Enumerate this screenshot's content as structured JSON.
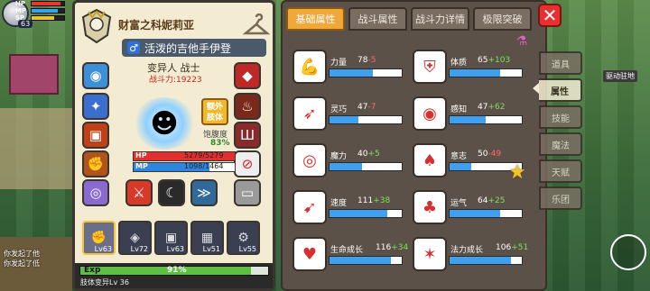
{
  "hud": {
    "hp_label": "HP",
    "mp_label": "MP",
    "sp_label": "SP",
    "level": "63"
  },
  "hero": {
    "name": "财富之科妮莉亚",
    "title": "活泼的吉他手伊登",
    "gender_symbol": "♂",
    "race_class": "变异人 战士",
    "power": "战斗力:19223",
    "extra_skill": "额外肢体",
    "satiety_label": "饱腹度",
    "satiety_value": "83%",
    "hp_label": "HP",
    "hp_value": "5279/5279",
    "hp_fraction": 1.0,
    "mp_label": "MP",
    "mp_value": "1098/1464",
    "mp_fraction": 0.75
  },
  "inventory": [
    {
      "level": "Lv63",
      "icon": "fist-icon",
      "selected": true
    },
    {
      "level": "Lv72",
      "icon": "crystal-icon",
      "selected": false
    },
    {
      "level": "Lv63",
      "icon": "armor-icon",
      "selected": false
    },
    {
      "level": "Lv51",
      "icon": "box-icon",
      "selected": false
    },
    {
      "level": "Lv55",
      "icon": "gear-icon",
      "selected": false
    }
  ],
  "exp": {
    "label": "Exp",
    "percent": "91%",
    "fraction": 0.91,
    "sub_label": "肢体变异Lv 36"
  },
  "tabs": [
    "基础属性",
    "战斗属性",
    "战斗力详情",
    "极限突破"
  ],
  "attributes": [
    {
      "name": "力量",
      "base": "78",
      "bonus": "-5",
      "fill": 0.6,
      "icon": "muscle-icon"
    },
    {
      "name": "体质",
      "base": "65",
      "bonus": "+103",
      "fill": 0.7,
      "icon": "armor-body-icon"
    },
    {
      "name": "灵巧",
      "base": "47",
      "bonus": "-7",
      "fill": 0.4,
      "icon": "runner-icon"
    },
    {
      "name": "感知",
      "base": "47",
      "bonus": "+62",
      "fill": 0.5,
      "icon": "eye-icon"
    },
    {
      "name": "魔力",
      "base": "40",
      "bonus": "+5",
      "fill": 0.45,
      "icon": "spiral-icon"
    },
    {
      "name": "意志",
      "base": "50",
      "bonus": "-49",
      "fill": 0.3,
      "icon": "flame-icon"
    },
    {
      "name": "速度",
      "base": "111",
      "bonus": "+38",
      "fill": 0.8,
      "icon": "wing-icon"
    },
    {
      "name": "运气",
      "base": "64",
      "bonus": "+25",
      "fill": 0.7,
      "icon": "clover-icon"
    },
    {
      "name": "生命成长",
      "base": "116",
      "bonus": "+34",
      "fill": 0.85,
      "icon": "heart-icon"
    },
    {
      "name": "法力成长",
      "base": "106",
      "bonus": "+51",
      "fill": 0.85,
      "icon": "star-swirl-icon"
    }
  ],
  "side_tabs": [
    "道具",
    "属性",
    "技能",
    "魔法",
    "天赋",
    "乐团"
  ],
  "world_label": "驱动驻地",
  "chat": [
    "你发起了他",
    "你发起了低"
  ],
  "colors": {
    "accent": "#f0a83a",
    "hp": "#e23030",
    "mp": "#2f86e0",
    "exp": "#5fbf43",
    "positive": "#7de05a",
    "negative": "#ff6a6a"
  }
}
